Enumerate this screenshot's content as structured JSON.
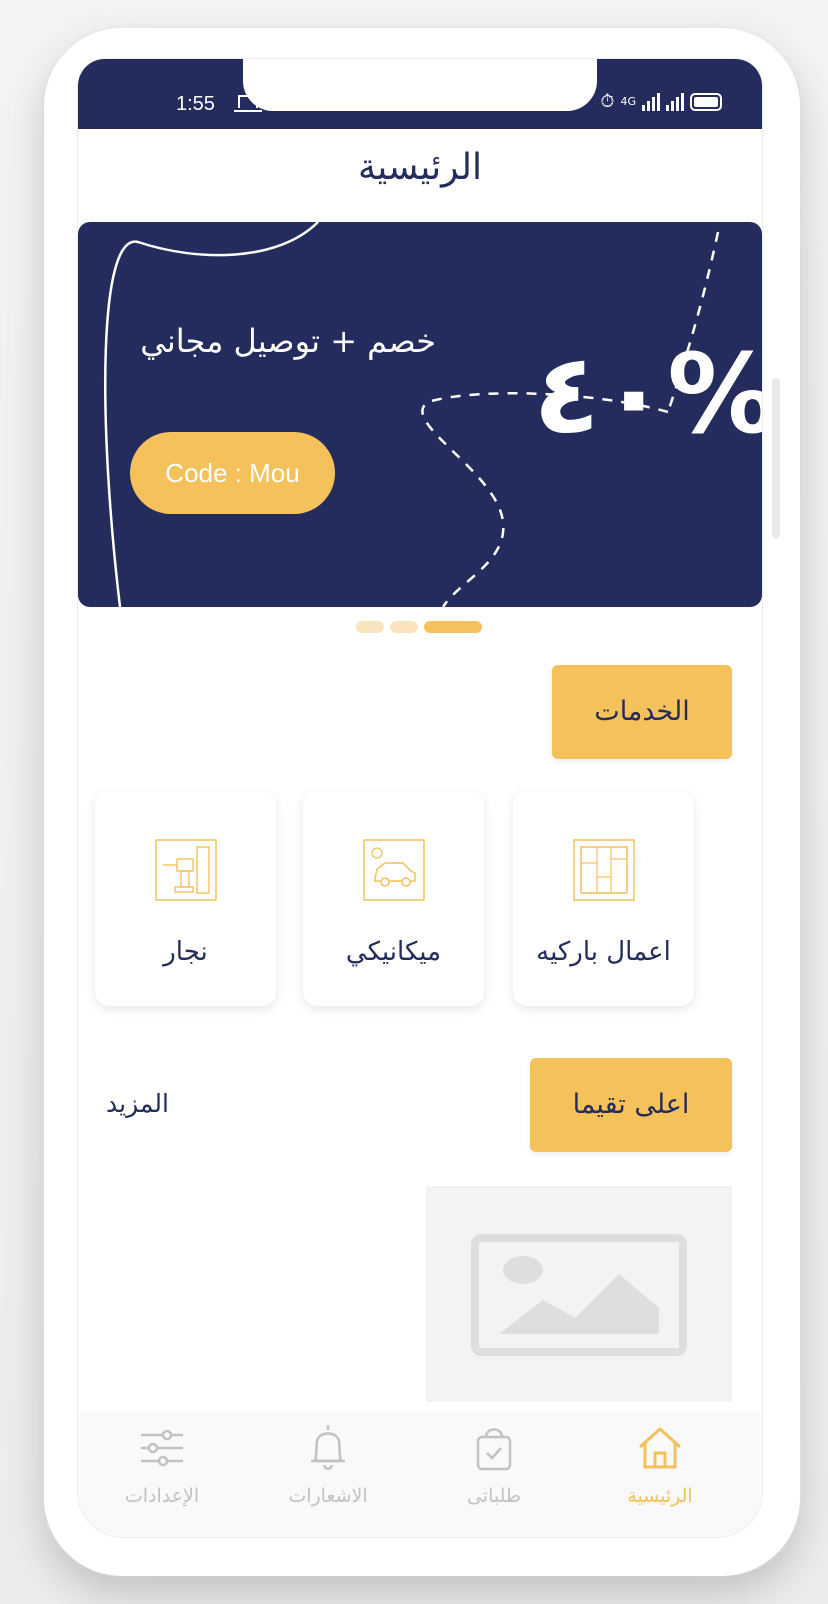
{
  "status_bar": {
    "time": "1:55",
    "network": "4G"
  },
  "header": {
    "title": "الرئيسية"
  },
  "banner": {
    "promo_text": "خصم + توصيل مجاني",
    "discount": "٤٠%",
    "code_button": "Code : Mou",
    "slide_count": 3,
    "active_slide": 3
  },
  "services": {
    "section_title": "الخدمات",
    "items": [
      {
        "label": "اعمال باركيه",
        "icon": "parquet-icon"
      },
      {
        "label": "ميكانيكي",
        "icon": "mechanic-car-icon"
      },
      {
        "label": "نجار",
        "icon": "carpenter-drill-icon"
      }
    ]
  },
  "top_rated": {
    "section_title": "اعلى تقيما",
    "more_label": "المزيد"
  },
  "tabbar": {
    "items": [
      {
        "label": "الرئيسية",
        "icon": "home-icon",
        "active": true
      },
      {
        "label": "طلباتى",
        "icon": "shopping-bag-icon",
        "active": false
      },
      {
        "label": "الاشعارات",
        "icon": "bell-icon",
        "active": false
      },
      {
        "label": "الإعدادات",
        "icon": "sliders-icon",
        "active": false
      }
    ]
  },
  "colors": {
    "navy": "#232c5c",
    "accent": "#f5c15a",
    "inactive": "#c2c2c2"
  }
}
